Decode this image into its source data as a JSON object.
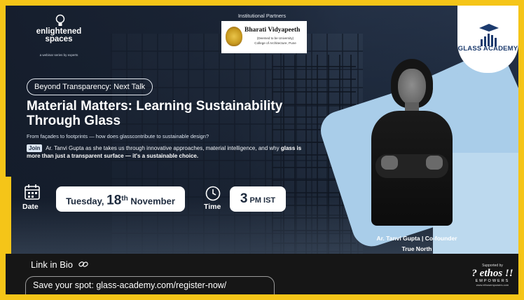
{
  "brand": {
    "name": "enlightened\nspaces",
    "tagline": "a webinar series by experts"
  },
  "partners": {
    "title": "Institutional Partners",
    "partner_name": "Bharati Vidyapeeth",
    "partner_sub1": "(Deemed to be University)",
    "partner_sub2": "College of Architecture, Pune"
  },
  "academy": {
    "name": "GLASS ACADEMY"
  },
  "event": {
    "series_label": "Beyond Transparency: Next Talk",
    "title": "Material Matters: Learning Sustainability Through Glass",
    "subtitle": "From façades to footprints — how does glasscontribute to sustainable design?",
    "join_label": "Join",
    "desc_part1": " Ar. Tanvi Gupta as she takes us through innovative approaches, material intelligence, and why ",
    "desc_bold": "glass is more than just a transparent surface — it's a sustainable choice.",
    "date_label": "Date",
    "date_day": "Tuesday, ",
    "date_num": "18",
    "date_suffix": "th",
    "date_month": " November",
    "time_label": "Time",
    "time_num": "3",
    "time_rest": " PM IST"
  },
  "presenter": {
    "name": "Ar. Tanvi Gupta | Co-founder",
    "org": "True North"
  },
  "footer": {
    "link_in_bio": "Link in Bio",
    "register_text": "Save your spot: glass-academy.com/register-now/",
    "supported_by": "Supported by",
    "sponsor_name": "? ethos !!",
    "sponsor_sub": "EMPOWERS",
    "sponsor_url": "www.ethosempowers.com"
  },
  "colors": {
    "frame": "#f5c518",
    "accent_blue": "#a9cde9",
    "navy": "#1d2a3d",
    "academy_text": "#1c3b6e"
  },
  "icons": [
    "bulb-icon",
    "calendar-icon",
    "clock-icon",
    "link-icon",
    "glass-academy-icon",
    "university-emblem-icon"
  ]
}
